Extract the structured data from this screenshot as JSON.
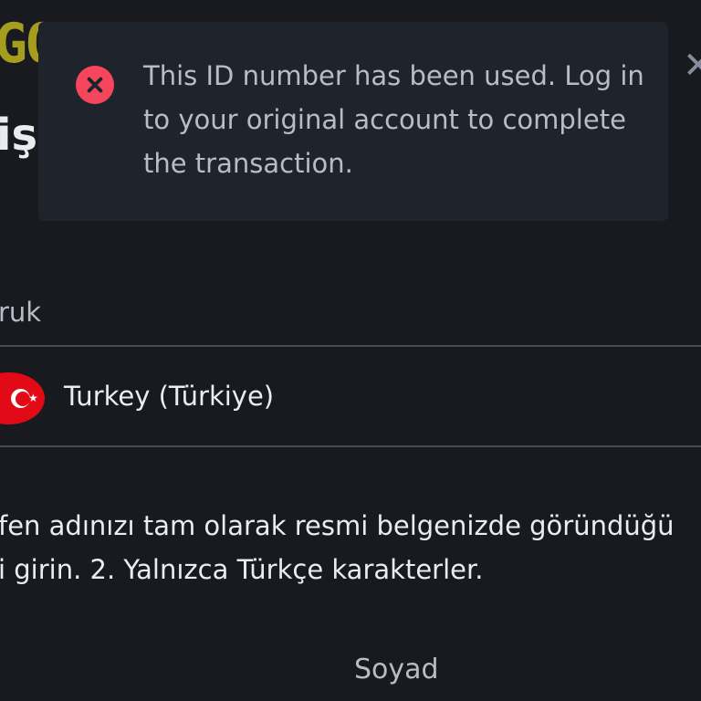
{
  "header": {
    "logo_fragment": "GO",
    "title_fragment": "işi"
  },
  "form": {
    "nationality_label": "ruk",
    "country": {
      "name": "Turkey (Türkiye)",
      "flag_icon": "turkey-flag-icon"
    },
    "instructions": {
      "line1": "fen adınızı tam olarak resmi belgenizde göründüğü",
      "line2": "i girin. 2. Yalnızca Türkçe karakterler."
    },
    "surname_label": "Soyad"
  },
  "toast": {
    "type": "error",
    "icon": "error-circle-icon",
    "message": "This ID number has been used. Log in to your original account to complete the transaction."
  },
  "colors": {
    "background": "#181a20",
    "toast_background": "#1f232b",
    "error": "#f6465d",
    "text_primary": "#eaecef",
    "text_secondary": "#b7bdc6",
    "divider": "#474d57",
    "logo": "#a69c1d"
  }
}
